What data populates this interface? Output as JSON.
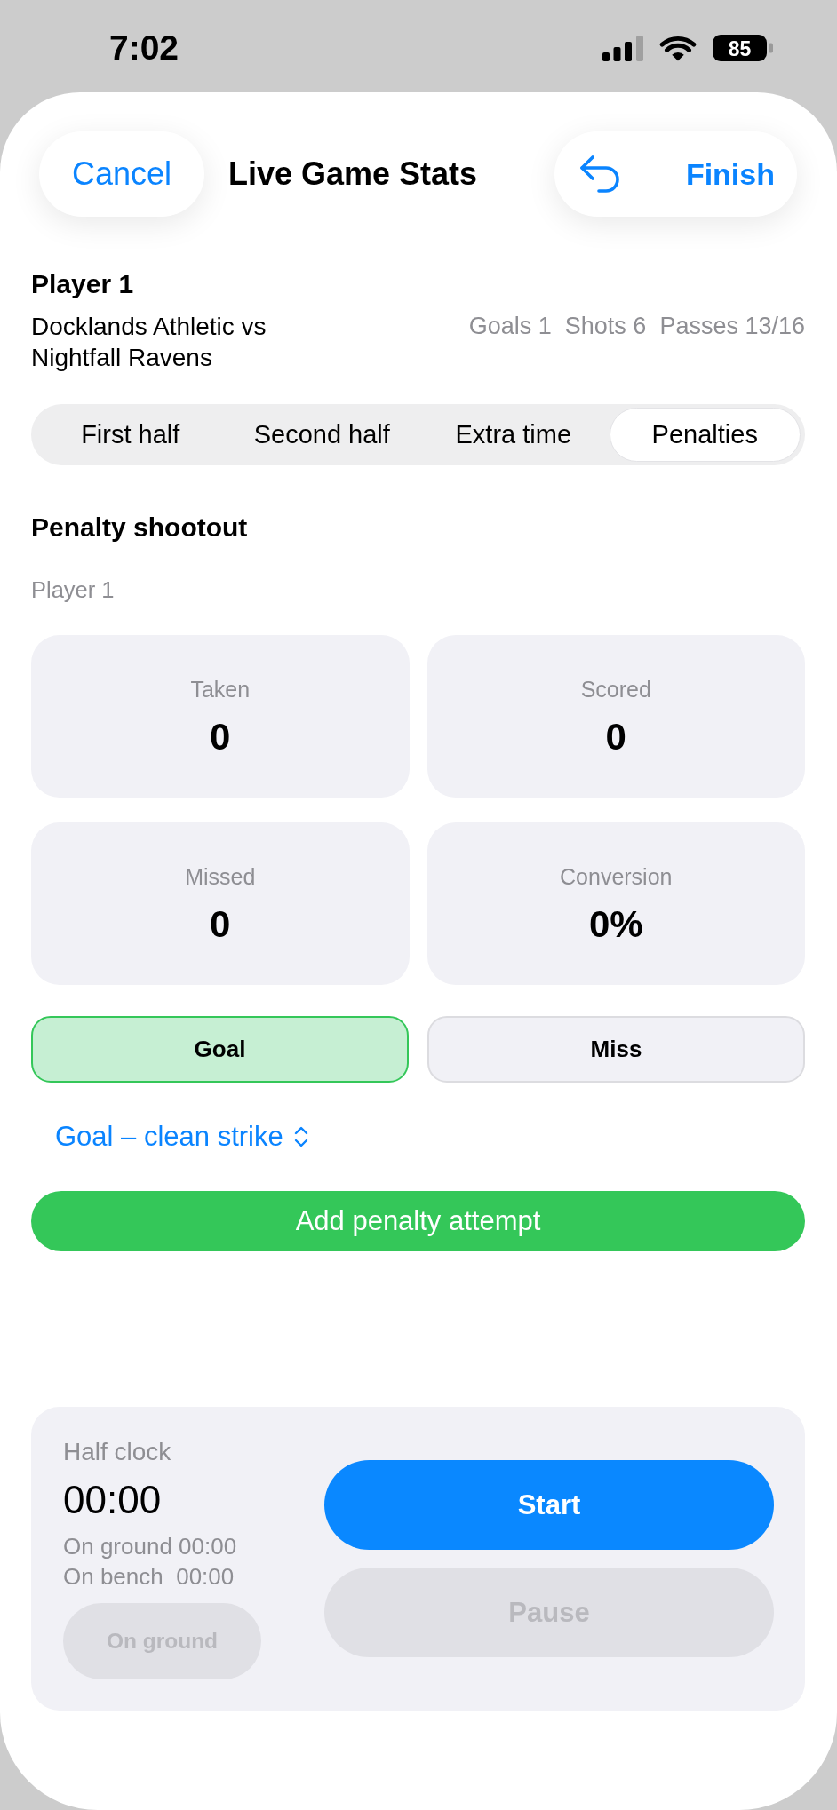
{
  "status_bar": {
    "time": "7:02",
    "battery": "85"
  },
  "header": {
    "cancel": "Cancel",
    "title": "Live Game Stats",
    "finish": "Finish"
  },
  "player": {
    "name": "Player 1",
    "match": "Docklands Athletic vs Nightfall Ravens",
    "stats": [
      "Goals 1",
      "Shots 6",
      "Passes 13/16"
    ]
  },
  "tabs": [
    {
      "label": "First half",
      "selected": false
    },
    {
      "label": "Second half",
      "selected": false
    },
    {
      "label": "Extra time",
      "selected": false
    },
    {
      "label": "Penalties",
      "selected": true
    }
  ],
  "section": {
    "title": "Penalty shootout",
    "subtitle": "Player 1"
  },
  "cards": [
    {
      "label": "Taken",
      "value": "0"
    },
    {
      "label": "Scored",
      "value": "0"
    },
    {
      "label": "Missed",
      "value": "0"
    },
    {
      "label": "Conversion",
      "value": "0%"
    }
  ],
  "outcomes": [
    {
      "label": "Goal",
      "kind": "goal",
      "selected": true
    },
    {
      "label": "Miss",
      "kind": "miss",
      "selected": false
    }
  ],
  "picker": {
    "value": "Goal – clean strike"
  },
  "add_button": "Add penalty attempt",
  "clock": {
    "title": "Half clock",
    "time": "00:00",
    "on_ground": "On ground 00:00",
    "on_bench": "On bench  00:00",
    "toggle": {
      "label": "On ground",
      "disabled": true
    },
    "actions": [
      {
        "label": "Start",
        "disabled": false
      },
      {
        "label": "Pause",
        "disabled": true
      }
    ]
  }
}
